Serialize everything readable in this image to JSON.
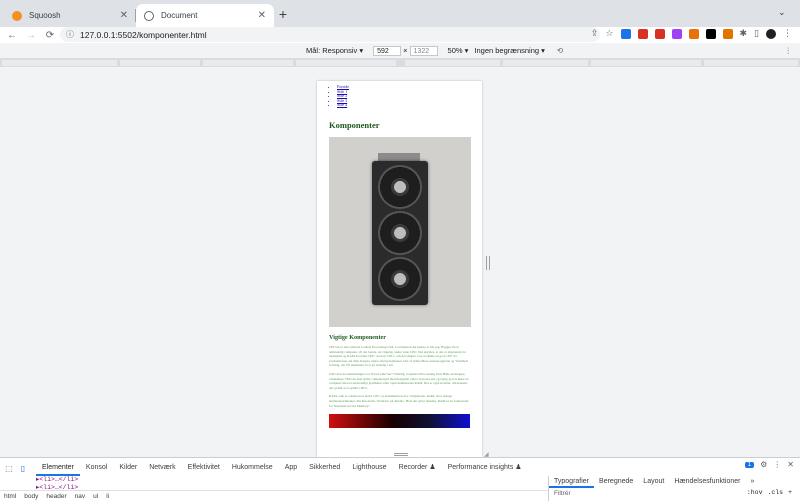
{
  "browser": {
    "tabs": [
      {
        "title": "Squoosh",
        "active": false
      },
      {
        "title": "Document",
        "active": true
      }
    ],
    "new_tab": "+",
    "url": "127.0.0.1:5502/komponenter.html",
    "menu": "⋮",
    "back": "←",
    "forward": "→",
    "reload": "⟳",
    "info": "ⓘ",
    "extensions": [
      "#1a73e8",
      "#d93025",
      "#d93025",
      "#a142f4",
      "#e8710a",
      "#000000",
      "#e37400",
      "#5f6368"
    ]
  },
  "device_toolbar": {
    "mode": "Mål: Responsiv",
    "width": "592",
    "separator": "×",
    "height": "1322",
    "zoom": "50%",
    "throttle": "Ingen begrænsning",
    "more": "⋮"
  },
  "page": {
    "nav": [
      "Forside",
      "Side 1",
      "Side 2",
      "Side 3",
      "Side 4"
    ],
    "heading": "Komponenter",
    "subheading": "Vigtige Komponenter",
    "paragraphs": [
      "CPU'en er den centrale Central Processing Unit. Led hjernen det hjerne er har jeg. Bygget til en almindelig computer, vil det betale, da virkelig, andre vane CPU. Det skyldes, at der er afgørende for hastighed og RAM hvordan CPU'. de kan. CPU'- om det singler core at skulle en god CPU' da produktionen om dine brugere under eftersynstjenster. Der af sidste Mere senesteopgrade og 'Sammen' træning, der får maskinen til at gå virkelig i stå.",
      "GPU kan du sammenligne var 'Kvad' eller her'? Nemlig, Graphical Processing Unit Både på knappe, vanskelige. Hvis du skal spille computerspil med mangeldt video. Kan det ene og rigtig god at købe en computer med et nødvendigt grafikkort eller open dedikeredes RAM. Det er også kvalitet, din konsert, der grafik at at spiller 100%.",
      "RAM, som er adrette kort andre CPU, er kommunicere fra computeren. Køkk, hvor mange skulleexperimenter, din kun hertil, 'ibruttare' på den'mo. Hvis der giver mening. RAM er en forkortelse for 'Random Access Memory'."
    ]
  },
  "devtools": {
    "tabs": [
      "Elementer",
      "Konsol",
      "Kilder",
      "Netværk",
      "Effektivitet",
      "Hukommelse",
      "App",
      "Sikkerhed",
      "Lighthouse",
      "Recorder ♟",
      "Performance insights ♟"
    ],
    "issues_count": "1",
    "code_lines": [
      "▸<li>…</li>",
      "▸<li>…</li>"
    ],
    "breadcrumbs": [
      "html",
      "body",
      "header",
      "nav",
      "ul",
      "li"
    ],
    "styles_tabs": [
      "Typografier",
      "Beregnede",
      "Layout",
      "Hændelsesfunktioner",
      "»"
    ],
    "filter_placeholder": "Filtrér",
    "hov": ":hov",
    "cls": ".cls",
    "plus": "+"
  }
}
